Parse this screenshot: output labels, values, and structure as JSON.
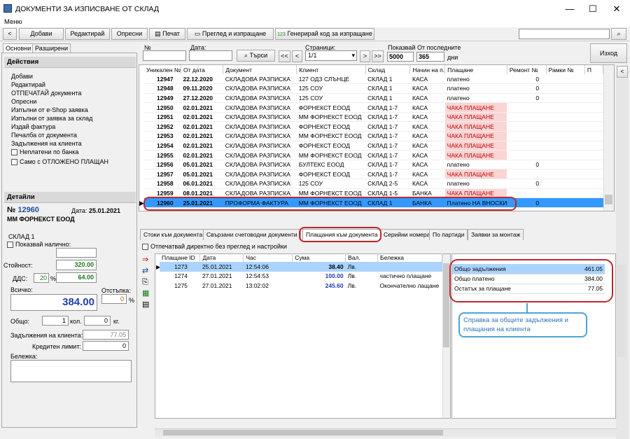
{
  "window": {
    "title": "ДОКУМЕНТИ ЗА ИЗПИСВАНЕ ОТ СКЛАД",
    "menu": "Меню"
  },
  "toolbar": {
    "back": "<",
    "add": "Добави",
    "edit": "Редактирай",
    "ops": "Опресни",
    "print": "Печат",
    "preview": "Преглед и изпращане",
    "gen": "Генерирай код за изпращане",
    "gen_prefix": "123"
  },
  "left": {
    "tab_basic": "Основни",
    "tab_ext": "Разширени",
    "actions_title": "Действия",
    "actions": [
      "Добави",
      "Редактирай",
      "ОТПЕЧАТАЙ документа",
      "Опресни",
      "Изпълни от e-Shop заявка",
      "Изпълни от заявка за склад",
      "Издай фактура",
      "Печалба от документа",
      "Задължения на клиента"
    ],
    "chk_unpaid": "Неплатени по банка",
    "chk_postponed": "Само с ОТЛОЖЕНО ПЛАЩАН",
    "details_title": "Детайли",
    "doc_no_label": "№",
    "doc_no": "12960",
    "date_label": "Дата:",
    "date": "25.01.2021",
    "client": "ММ ФОРНЕКСТ ЕООД",
    "warehouse": "СКЛАД 1",
    "show_stock": "Показвай налично:",
    "value_label": "Стойност:",
    "value": "320.00",
    "vat_label": "ДДС:",
    "vat_pct": "20",
    "pct": "%",
    "vat": "64.00",
    "total_label": "Всичко:",
    "total": "384.00",
    "discount_label": "Отстъпка:",
    "discount": "0",
    "overall_label": "Общо:",
    "qty": "1",
    "qty_unit": "кол.",
    "weight": "0",
    "weight_unit": "кг.",
    "client_debt_label": "Задължения на клиента:",
    "client_debt": "77.05",
    "credit_label": "Кредитен лимит:",
    "credit": "0",
    "note_label": "Бележка:"
  },
  "filters": {
    "no_label": "№",
    "date_label": "Дата:",
    "search": "Търси",
    "pages_label": "Страници:",
    "page_value": "1/1",
    "shown_label": "Показвай",
    "shown_value": "5000",
    "last_label": "От последните",
    "last_value": "365",
    "days": "дни",
    "exit": "Изход",
    "nav_first": "<<",
    "nav_prev": "<",
    "nav_next": ">",
    "nav_last": ">>"
  },
  "docs": {
    "columns": [
      "Уникален №",
      "От дата",
      "Документ",
      "Клиент",
      "Склад",
      "Начин на п.",
      "Плащане",
      "Ремонт №",
      "Рамки №",
      "П"
    ],
    "rows": [
      [
        "12947",
        "22.12.2020",
        "СКЛАДОВА РАЗПИСКА",
        "127 ОДЗ СЛЪНЦЕ",
        "СКЛАД 1",
        "КАСА",
        "платено",
        "0"
      ],
      [
        "12948",
        "09.11.2020",
        "СКЛАДОВА РАЗПИСКА",
        "125 СОУ",
        "СКЛАД 1",
        "КАСА",
        "платено",
        "0"
      ],
      [
        "12949",
        "27.12.2020",
        "СКЛАДОВА РАЗПИСКА",
        "125 СОУ",
        "СКЛАД 1",
        "КАСА",
        "платено",
        "0"
      ],
      [
        "12950",
        "02.01.2021",
        "СКЛАДОВА РАЗПИСКА",
        "ФОРНЕКСТ ЕООД",
        "СКЛАД 1-7",
        "КАСА",
        "ЧАКА ПЛАЩАНЕ",
        ""
      ],
      [
        "12951",
        "02.01.2021",
        "СКЛАДОВА РАЗПИСКА",
        "ММ ФОРНЕКСТ ЕООД",
        "СКЛАД 1-7",
        "КАСА",
        "ЧАКА ПЛАЩАНЕ",
        ""
      ],
      [
        "12952",
        "02.01.2021",
        "СКЛАДОВА РАЗПИСКА",
        "ФОРНЕКСТ ЕООД",
        "СКЛАД 1-7",
        "КАСА",
        "ЧАКА ПЛАЩАНЕ",
        ""
      ],
      [
        "12953",
        "02.01.2021",
        "СКЛАДОВА РАЗПИСКА",
        "ММ ФОРНЕКСТ ЕООД",
        "СКЛАД 1-7",
        "КАСА",
        "ЧАКА ПЛАЩАНЕ",
        ""
      ],
      [
        "12954",
        "02.01.2021",
        "СКЛАДОВА РАЗПИСКА",
        "ФОРНЕКСТ ЕООД",
        "СКЛАД 1-7",
        "КАСА",
        "ЧАКА ПЛАЩАНЕ",
        ""
      ],
      [
        "12955",
        "02.01.2021",
        "СКЛАДОВА РАЗПИСКА",
        "ММ ФОРНЕКСТ ЕООД",
        "СКЛАД 1-7",
        "КАСА",
        "ЧАКА ПЛАЩАНЕ",
        ""
      ],
      [
        "12956",
        "05.01.2021",
        "СКЛАДОВА РАЗПИСКА",
        "БУЛТЕКС ЕООД",
        "СКЛАД 1-7",
        "КАСА",
        "платено",
        "0"
      ],
      [
        "12957",
        "05.01.2021",
        "СКЛАДОВА РАЗПИСКА",
        "ФОРНЕКСТ ЕООД",
        "СКЛАД 1-7",
        "КАСА",
        "ЧАКА ПЛАЩАНЕ",
        ""
      ],
      [
        "12958",
        "06.01.2021",
        "СКЛАДОВА РАЗПИСКА",
        "125 СОУ",
        "СКЛАД 2-5",
        "КАСА",
        "платено",
        "0"
      ],
      [
        "12959",
        "08.01.2021",
        "СКЛАДОВА РАЗПИСКА",
        "ММ ФОРНЕКСТ ЕООД",
        "СКЛАД 1-5",
        "БАНКА",
        "ЧАКА ПЛАЩАНЕ",
        ""
      ],
      [
        "12960",
        "25.01.2021",
        "ПРОФОРМА ФАКТУРА",
        "ММ ФОРНЕКСТ ЕООД",
        "СКЛАД 1",
        "БАНКА",
        "Платено НА ВНОСКИ",
        "0"
      ]
    ]
  },
  "bottom_tabs": [
    "Стоки към документа",
    "Свързани счетоводни документи",
    "Плащания към документа",
    "Серийни номера",
    "По партиди",
    "Заявки за монтаж"
  ],
  "print_direct": "Отпечатвай директно без преглед и настройки",
  "payments": {
    "columns": [
      "Плащане ID",
      "Дата",
      "Час",
      "Сума",
      "Вал.",
      "Бележка"
    ],
    "rows": [
      [
        "1273",
        "25.01.2021",
        "12:54:06",
        "38.40",
        "Лв.",
        ""
      ],
      [
        "1274",
        "27.01.2021",
        "12:54:53",
        "100.00",
        "Лв.",
        "частично плащане"
      ],
      [
        "1275",
        "27.01.2021",
        "13:02:02",
        "245.60",
        "Лв.",
        "Окончателно лащане"
      ]
    ]
  },
  "summary": [
    {
      "label": "Общо задължения",
      "value": "461.05"
    },
    {
      "label": "Общо платено",
      "value": "384.00"
    },
    {
      "label": "Остатък за плащане",
      "value": "77.05"
    }
  ],
  "callout": "Справка за общите задължения и плащания на клиента",
  "colors": {
    "accent": "#3399ff",
    "wait": "#c00000",
    "highlight": "#c0262c",
    "callout": "#4da3d8"
  }
}
